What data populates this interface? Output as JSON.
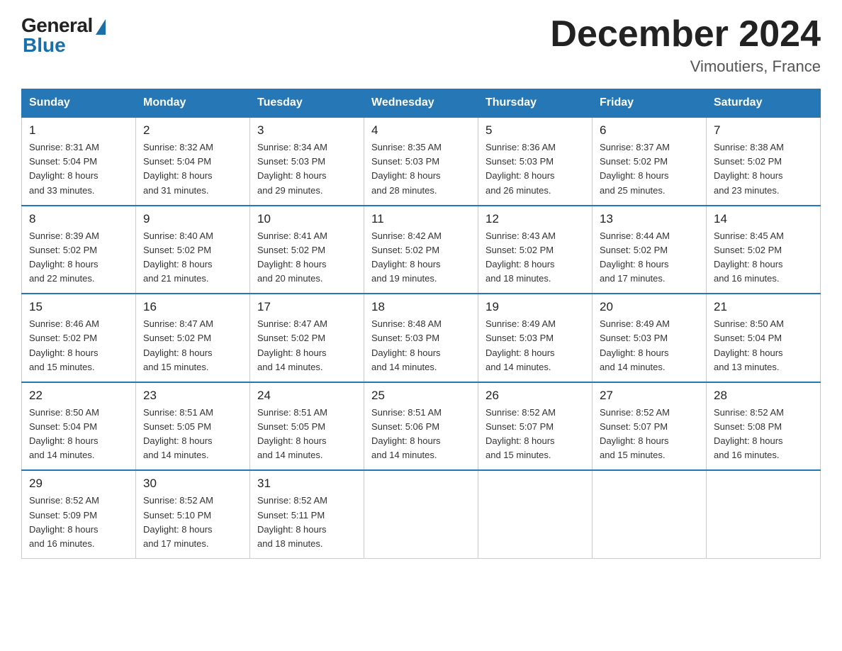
{
  "header": {
    "logo_general": "General",
    "logo_blue": "Blue",
    "month_title": "December 2024",
    "location": "Vimoutiers, France"
  },
  "days_of_week": [
    "Sunday",
    "Monday",
    "Tuesday",
    "Wednesday",
    "Thursday",
    "Friday",
    "Saturday"
  ],
  "weeks": [
    [
      {
        "day": "1",
        "sunrise": "8:31 AM",
        "sunset": "5:04 PM",
        "daylight": "8 hours and 33 minutes."
      },
      {
        "day": "2",
        "sunrise": "8:32 AM",
        "sunset": "5:04 PM",
        "daylight": "8 hours and 31 minutes."
      },
      {
        "day": "3",
        "sunrise": "8:34 AM",
        "sunset": "5:03 PM",
        "daylight": "8 hours and 29 minutes."
      },
      {
        "day": "4",
        "sunrise": "8:35 AM",
        "sunset": "5:03 PM",
        "daylight": "8 hours and 28 minutes."
      },
      {
        "day": "5",
        "sunrise": "8:36 AM",
        "sunset": "5:03 PM",
        "daylight": "8 hours and 26 minutes."
      },
      {
        "day": "6",
        "sunrise": "8:37 AM",
        "sunset": "5:02 PM",
        "daylight": "8 hours and 25 minutes."
      },
      {
        "day": "7",
        "sunrise": "8:38 AM",
        "sunset": "5:02 PM",
        "daylight": "8 hours and 23 minutes."
      }
    ],
    [
      {
        "day": "8",
        "sunrise": "8:39 AM",
        "sunset": "5:02 PM",
        "daylight": "8 hours and 22 minutes."
      },
      {
        "day": "9",
        "sunrise": "8:40 AM",
        "sunset": "5:02 PM",
        "daylight": "8 hours and 21 minutes."
      },
      {
        "day": "10",
        "sunrise": "8:41 AM",
        "sunset": "5:02 PM",
        "daylight": "8 hours and 20 minutes."
      },
      {
        "day": "11",
        "sunrise": "8:42 AM",
        "sunset": "5:02 PM",
        "daylight": "8 hours and 19 minutes."
      },
      {
        "day": "12",
        "sunrise": "8:43 AM",
        "sunset": "5:02 PM",
        "daylight": "8 hours and 18 minutes."
      },
      {
        "day": "13",
        "sunrise": "8:44 AM",
        "sunset": "5:02 PM",
        "daylight": "8 hours and 17 minutes."
      },
      {
        "day": "14",
        "sunrise": "8:45 AM",
        "sunset": "5:02 PM",
        "daylight": "8 hours and 16 minutes."
      }
    ],
    [
      {
        "day": "15",
        "sunrise": "8:46 AM",
        "sunset": "5:02 PM",
        "daylight": "8 hours and 15 minutes."
      },
      {
        "day": "16",
        "sunrise": "8:47 AM",
        "sunset": "5:02 PM",
        "daylight": "8 hours and 15 minutes."
      },
      {
        "day": "17",
        "sunrise": "8:47 AM",
        "sunset": "5:02 PM",
        "daylight": "8 hours and 14 minutes."
      },
      {
        "day": "18",
        "sunrise": "8:48 AM",
        "sunset": "5:03 PM",
        "daylight": "8 hours and 14 minutes."
      },
      {
        "day": "19",
        "sunrise": "8:49 AM",
        "sunset": "5:03 PM",
        "daylight": "8 hours and 14 minutes."
      },
      {
        "day": "20",
        "sunrise": "8:49 AM",
        "sunset": "5:03 PM",
        "daylight": "8 hours and 14 minutes."
      },
      {
        "day": "21",
        "sunrise": "8:50 AM",
        "sunset": "5:04 PM",
        "daylight": "8 hours and 13 minutes."
      }
    ],
    [
      {
        "day": "22",
        "sunrise": "8:50 AM",
        "sunset": "5:04 PM",
        "daylight": "8 hours and 14 minutes."
      },
      {
        "day": "23",
        "sunrise": "8:51 AM",
        "sunset": "5:05 PM",
        "daylight": "8 hours and 14 minutes."
      },
      {
        "day": "24",
        "sunrise": "8:51 AM",
        "sunset": "5:05 PM",
        "daylight": "8 hours and 14 minutes."
      },
      {
        "day": "25",
        "sunrise": "8:51 AM",
        "sunset": "5:06 PM",
        "daylight": "8 hours and 14 minutes."
      },
      {
        "day": "26",
        "sunrise": "8:52 AM",
        "sunset": "5:07 PM",
        "daylight": "8 hours and 15 minutes."
      },
      {
        "day": "27",
        "sunrise": "8:52 AM",
        "sunset": "5:07 PM",
        "daylight": "8 hours and 15 minutes."
      },
      {
        "day": "28",
        "sunrise": "8:52 AM",
        "sunset": "5:08 PM",
        "daylight": "8 hours and 16 minutes."
      }
    ],
    [
      {
        "day": "29",
        "sunrise": "8:52 AM",
        "sunset": "5:09 PM",
        "daylight": "8 hours and 16 minutes."
      },
      {
        "day": "30",
        "sunrise": "8:52 AM",
        "sunset": "5:10 PM",
        "daylight": "8 hours and 17 minutes."
      },
      {
        "day": "31",
        "sunrise": "8:52 AM",
        "sunset": "5:11 PM",
        "daylight": "8 hours and 18 minutes."
      },
      null,
      null,
      null,
      null
    ]
  ],
  "labels": {
    "sunrise_prefix": "Sunrise: ",
    "sunset_prefix": "Sunset: ",
    "daylight_prefix": "Daylight: "
  }
}
